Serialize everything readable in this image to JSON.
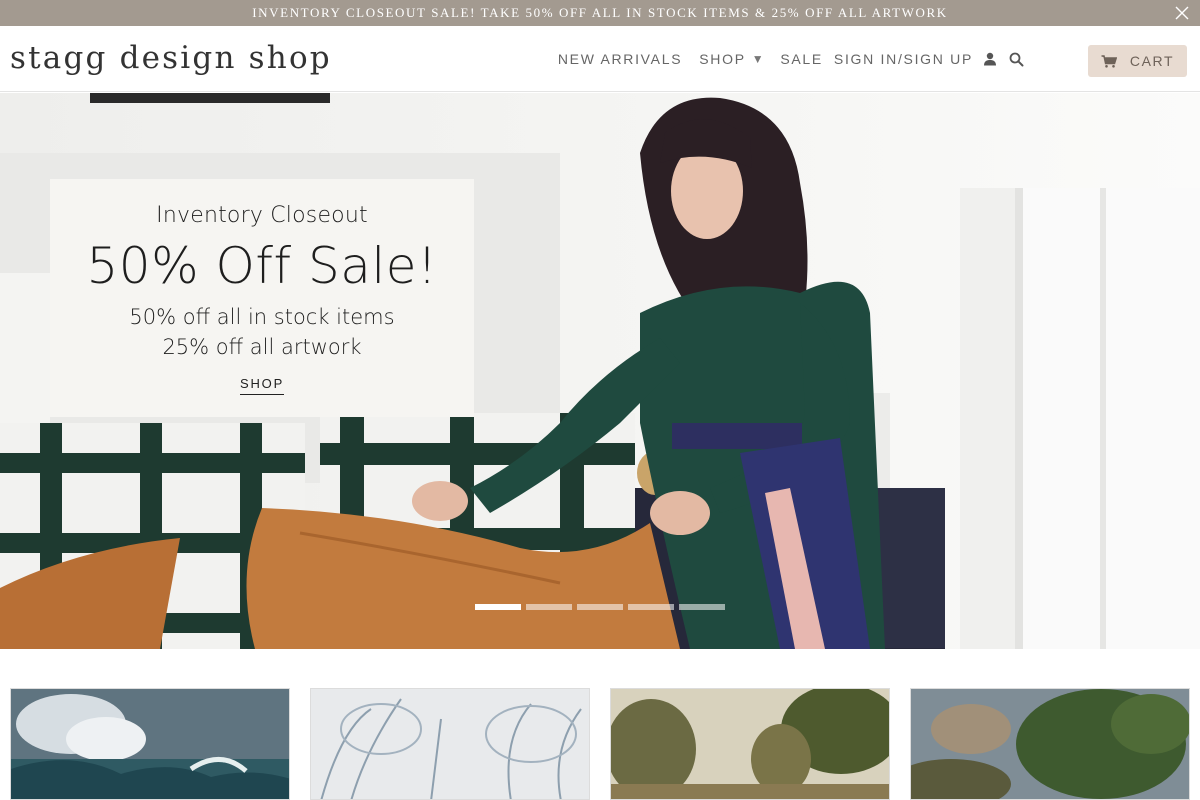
{
  "announcement": {
    "text": "INVENTORY CLOSEOUT SALE! TAKE 50% OFF ALL IN STOCK ITEMS & 25% OFF ALL ARTWORK",
    "close_icon": "close-icon"
  },
  "header": {
    "logo": "stagg design shop",
    "nav": {
      "new_arrivals": "NEW ARRIVALS",
      "shop": "SHOP",
      "sale": "SALE",
      "sign_in": "SIGN IN/SIGN UP"
    },
    "icons": {
      "account": "user-icon",
      "search": "search-icon",
      "cart": "cart-icon",
      "dropdown": "chevron-down-icon"
    },
    "cart_label": "CART"
  },
  "hero": {
    "eyebrow": "Inventory Closeout",
    "headline": "50% Off Sale!",
    "line1": "50% off all in stock items",
    "line2": "25% off all artwork",
    "cta": "SHOP",
    "slide_count": 5,
    "active_slide": 1
  },
  "products": [
    {
      "name": "product-tile-seascape"
    },
    {
      "name": "product-tile-sketch"
    },
    {
      "name": "product-tile-landscape"
    },
    {
      "name": "product-tile-trees"
    }
  ],
  "colors": {
    "announcement_bg": "#a39a90",
    "cart_bg": "#e8dbd1",
    "dress": "#1f4a3f"
  }
}
